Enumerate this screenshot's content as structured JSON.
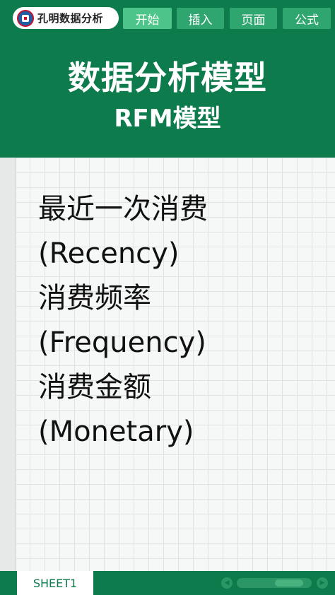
{
  "brand": {
    "name": "孔明数据分析",
    "logo_icon": "kongming-logo-icon"
  },
  "ribbon": {
    "tabs": [
      {
        "label": "开始",
        "active": true
      },
      {
        "label": "插入",
        "active": false
      },
      {
        "label": "页面",
        "active": false
      },
      {
        "label": "公式",
        "active": false
      }
    ]
  },
  "banner": {
    "title": "数据分析模型",
    "subtitle": "RFM模型"
  },
  "content": {
    "lines": [
      "最近一次消费",
      "(Recency)",
      "消费频率",
      "(Frequency)",
      "消费金额",
      "(Monetary)"
    ]
  },
  "footer": {
    "sheet_tab": "SHEET1",
    "scroll_left_icon": "chevron-left-icon",
    "scroll_right_icon": "chevron-right-icon"
  },
  "colors": {
    "primary_green": "#0e7b4d",
    "tab_green": "#2fa56f",
    "tab_active": "#4cc48a",
    "grid_line": "#dfe3e1"
  }
}
